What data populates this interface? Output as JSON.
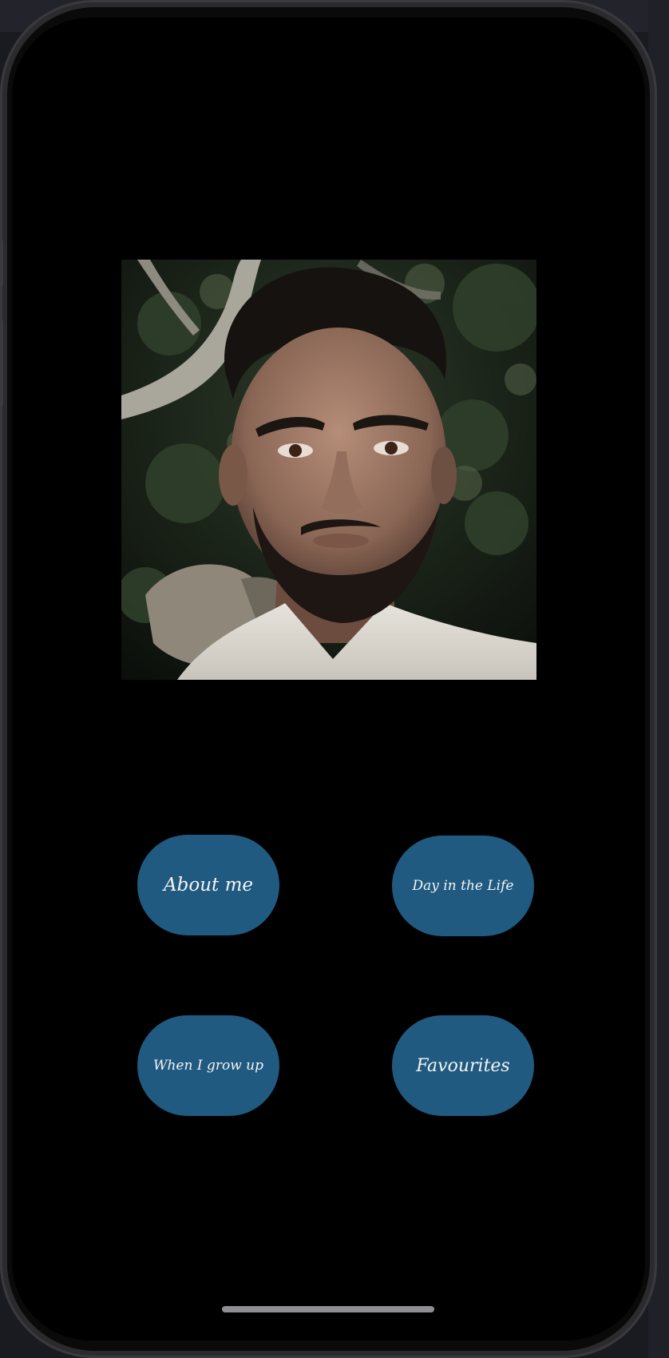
{
  "screen": {
    "background": "#000000"
  },
  "profile": {
    "photo_description": "portrait-photo"
  },
  "buttons": {
    "about_label": "About me",
    "day_label": "Day in the Life",
    "grow_label": "When I grow up",
    "favourites_label": "Favourites",
    "color": "#205a80",
    "text_color": "#f4f4f4"
  }
}
